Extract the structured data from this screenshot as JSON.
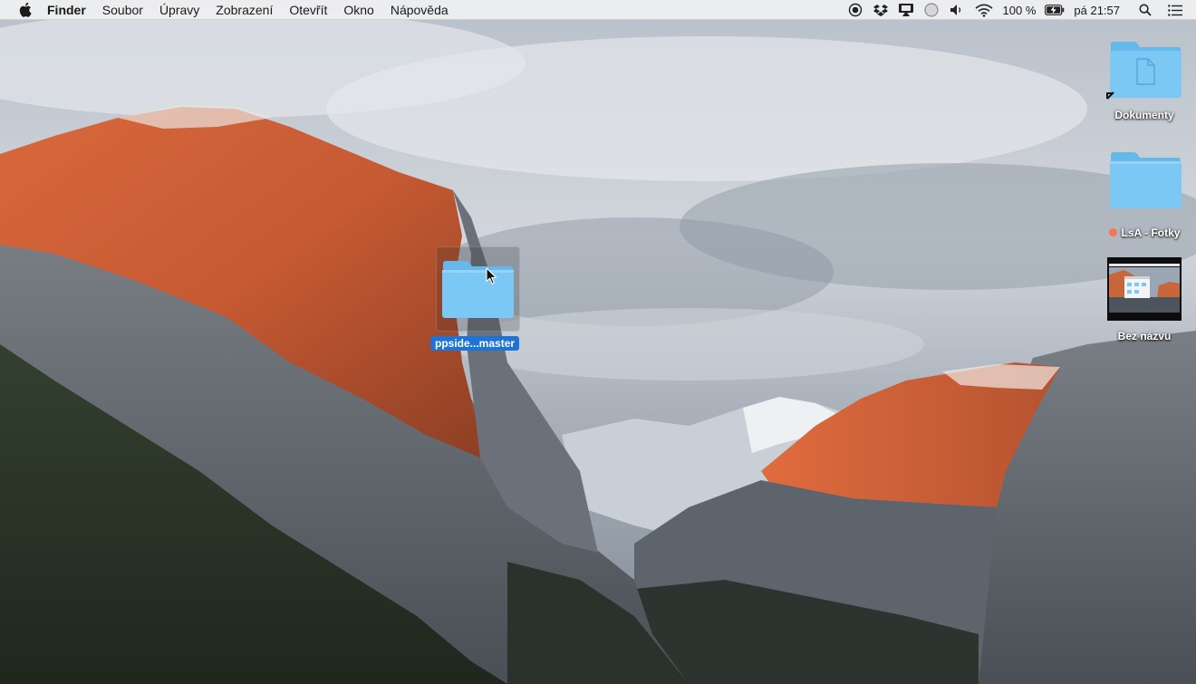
{
  "menubar": {
    "app_name": "Finder",
    "menus": [
      "Soubor",
      "Úpravy",
      "Zobrazení",
      "Otevřít",
      "Okno",
      "Nápověda"
    ],
    "status": {
      "battery": "100 %",
      "clock": "pá 21:57"
    },
    "icons": [
      "apple-icon",
      "record-icon",
      "dropbox-icon",
      "airplay-icon",
      "circle-status-icon",
      "volume-icon",
      "wifi-icon",
      "battery-icon",
      "spotlight-icon",
      "notification-center-icon"
    ]
  },
  "desktop": {
    "dragged_item": {
      "label": "ppside...master",
      "icon": "folder-icon"
    },
    "items": [
      {
        "label": "Dokumenty",
        "icon": "documents-folder-alias-icon"
      },
      {
        "label": "LsA - Fotky",
        "icon": "folder-icon",
        "tag_color": "#f4754f"
      },
      {
        "label": "Bez názvu",
        "icon": "screenshot-thumbnail-icon"
      }
    ]
  },
  "colors": {
    "folder": "#7cc8f4",
    "selection": "#1c74d8"
  }
}
